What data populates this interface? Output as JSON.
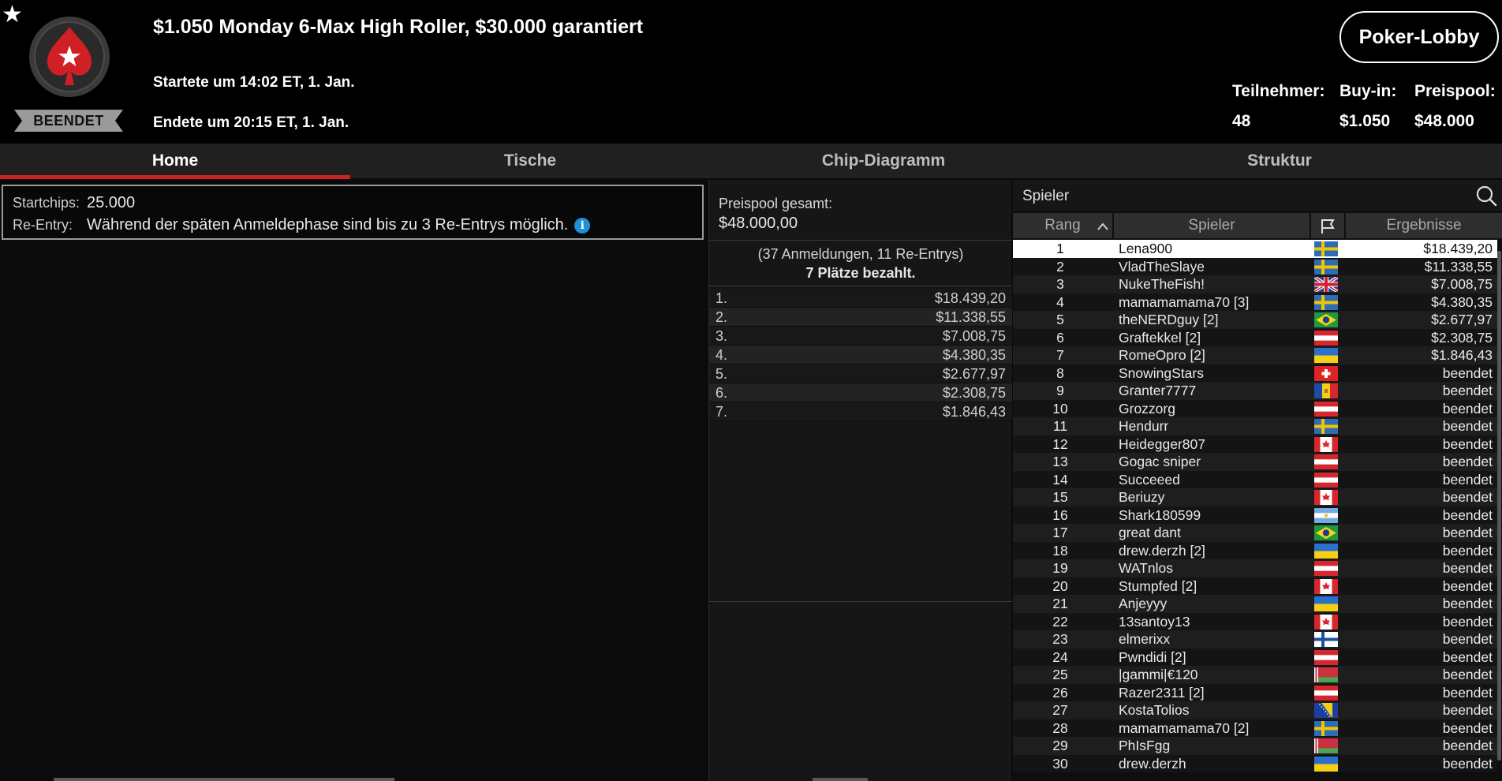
{
  "header": {
    "title": "$1.050 Monday 6-Max High Roller, $30.000 garantiert",
    "started": "Startete um 14:02 ET, 1. Jan.",
    "ended": "Endete um 20:15 ET, 1. Jan.",
    "status": "BEENDET",
    "lobby_button": "Poker-Lobby",
    "stats": [
      {
        "label": "Teilnehmer:",
        "value": "48"
      },
      {
        "label": "Buy-in:",
        "value": "$1.050"
      },
      {
        "label": "Preispool:",
        "value": "$48.000"
      }
    ],
    "favorite_icon": "star-icon",
    "logo_icon": "spade-star-logo"
  },
  "tabs": [
    {
      "label": "Home",
      "active": true
    },
    {
      "label": "Tische",
      "active": false
    },
    {
      "label": "Chip-Diagramm",
      "active": false
    },
    {
      "label": "Struktur",
      "active": false
    }
  ],
  "info": {
    "startchips_label": "Startchips:",
    "startchips_value": "25.000",
    "reentry_label": "Re-Entry:",
    "reentry_value": "Während der späten Anmeldephase sind bis zu 3 Re-Entrys möglich.",
    "info_icon": "i"
  },
  "prizepool": {
    "label": "Preispool gesamt:",
    "total": "$48.000,00",
    "entries": "(37 Anmeldungen, 11 Re-Entrys)",
    "paid": "7 Plätze bezahlt.",
    "payouts": [
      {
        "place": "1.",
        "amount": "$18.439,20"
      },
      {
        "place": "2.",
        "amount": "$11.338,55"
      },
      {
        "place": "3.",
        "amount": "$7.008,75"
      },
      {
        "place": "4.",
        "amount": "$4.380,35"
      },
      {
        "place": "5.",
        "amount": "$2.677,97"
      },
      {
        "place": "6.",
        "amount": "$2.308,75"
      },
      {
        "place": "7.",
        "amount": "$1.846,43"
      }
    ]
  },
  "players": {
    "title": "Spieler",
    "columns": {
      "rank": "Rang",
      "player": "Spieler",
      "result": "Ergebnisse"
    },
    "sort_icon": "chevron-up-icon",
    "flag_column_icon": "flag-icon",
    "rows": [
      {
        "rank": "1",
        "name": "Lena900",
        "flag": "se",
        "result": "$18.439,20"
      },
      {
        "rank": "2",
        "name": "VladTheSlaye",
        "flag": "se",
        "result": "$11.338,55"
      },
      {
        "rank": "3",
        "name": "NukeTheFish!",
        "flag": "gb",
        "result": "$7.008,75"
      },
      {
        "rank": "4",
        "name": "mamamamama70 [3]",
        "flag": "se",
        "result": "$4.380,35"
      },
      {
        "rank": "5",
        "name": "theNERDguy [2]",
        "flag": "br",
        "result": "$2.677,97"
      },
      {
        "rank": "6",
        "name": "Graftekkel [2]",
        "flag": "at",
        "result": "$2.308,75"
      },
      {
        "rank": "7",
        "name": "RomeOpro [2]",
        "flag": "ua",
        "result": "$1.846,43"
      },
      {
        "rank": "8",
        "name": "SnowingStars",
        "flag": "ch",
        "result": "beendet"
      },
      {
        "rank": "9",
        "name": "Granter7777",
        "flag": "md",
        "result": "beendet"
      },
      {
        "rank": "10",
        "name": "Grozzorg",
        "flag": "at",
        "result": "beendet"
      },
      {
        "rank": "11",
        "name": "Hendurr",
        "flag": "se",
        "result": "beendet"
      },
      {
        "rank": "12",
        "name": "Heidegger807",
        "flag": "ca",
        "result": "beendet"
      },
      {
        "rank": "13",
        "name": "Gogac sniper",
        "flag": "at",
        "result": "beendet"
      },
      {
        "rank": "14",
        "name": "Succeeed",
        "flag": "at",
        "result": "beendet"
      },
      {
        "rank": "15",
        "name": "Beriuzy",
        "flag": "ca",
        "result": "beendet"
      },
      {
        "rank": "16",
        "name": "Shark180599",
        "flag": "ar",
        "result": "beendet"
      },
      {
        "rank": "17",
        "name": "great dant",
        "flag": "br",
        "result": "beendet"
      },
      {
        "rank": "18",
        "name": "drew.derzh [2]",
        "flag": "ua",
        "result": "beendet"
      },
      {
        "rank": "19",
        "name": "WATnlos",
        "flag": "at",
        "result": "beendet"
      },
      {
        "rank": "20",
        "name": "Stumpfed [2]",
        "flag": "ca",
        "result": "beendet"
      },
      {
        "rank": "21",
        "name": "Anjeyyy",
        "flag": "ua",
        "result": "beendet"
      },
      {
        "rank": "22",
        "name": "13santoy13",
        "flag": "ca",
        "result": "beendet"
      },
      {
        "rank": "23",
        "name": "elmerixx",
        "flag": "fi",
        "result": "beendet"
      },
      {
        "rank": "24",
        "name": "Pwndidi [2]",
        "flag": "at",
        "result": "beendet"
      },
      {
        "rank": "25",
        "name": "|gammi|€120",
        "flag": "by",
        "result": "beendet"
      },
      {
        "rank": "26",
        "name": "Razer2311 [2]",
        "flag": "at",
        "result": "beendet"
      },
      {
        "rank": "27",
        "name": "KostaTolios",
        "flag": "ba",
        "result": "beendet"
      },
      {
        "rank": "28",
        "name": "mamamamama70 [2]",
        "flag": "se",
        "result": "beendet"
      },
      {
        "rank": "29",
        "name": "PhIsFgg",
        "flag": "by",
        "result": "beendet"
      },
      {
        "rank": "30",
        "name": "drew.derzh",
        "flag": "ua",
        "result": "beendet"
      }
    ]
  },
  "colors": {
    "accent_red": "#d11f26",
    "info_blue": "#1f8fd6",
    "selected_row": "#ffffff"
  }
}
